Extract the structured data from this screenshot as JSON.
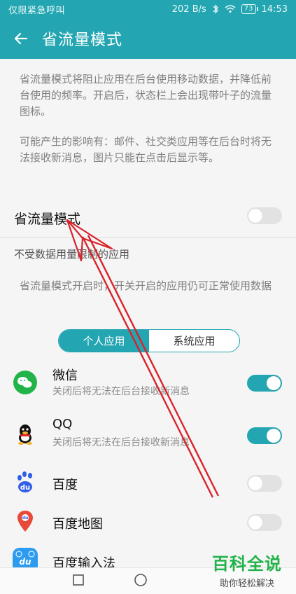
{
  "status_bar": {
    "carrier": "仅限紧急呼叫",
    "network_speed": "202 B/s",
    "battery": "73",
    "time": "14:53"
  },
  "app_bar": {
    "title": "省流量模式",
    "back_icon": "back-arrow-icon"
  },
  "description": {
    "p1": "省流量模式将阻止应用在后台使用移动数据，并降低前台使用的频率。开启后，状态栏上会出现带叶子的流量图标。",
    "p2": "可能产生的影响有：邮件、社交类应用等在后台时将无法接收新消息，图片只能在点击后显示等。"
  },
  "data_saver": {
    "label": "省流量模式",
    "enabled": false
  },
  "unrestricted_section": {
    "title": "不受数据用量限制的应用",
    "hint": "省流量模式开启时，开关开启的应用仍可正常使用数据",
    "tabs": [
      "个人应用",
      "系统应用"
    ],
    "active_tab": 0
  },
  "apps": [
    {
      "name": "微信",
      "subtitle": "关闭后将无法在后台接收新消息",
      "enabled": true,
      "icon": "wechat-icon"
    },
    {
      "name": "QQ",
      "subtitle": "关闭后将无法在后台接收新消息",
      "enabled": true,
      "icon": "qq-icon"
    },
    {
      "name": "百度",
      "subtitle": "",
      "enabled": false,
      "icon": "baidu-icon"
    },
    {
      "name": "百度地图",
      "subtitle": "",
      "enabled": false,
      "icon": "baidu-map-icon"
    },
    {
      "name": "百度输入法",
      "subtitle": "",
      "enabled": false,
      "icon": "baidu-input-icon"
    }
  ],
  "watermark": {
    "main": "百科全说",
    "sub": "助你轻松解决"
  },
  "colors": {
    "accent": "#23a6b1",
    "arrow": "#d9232b"
  }
}
